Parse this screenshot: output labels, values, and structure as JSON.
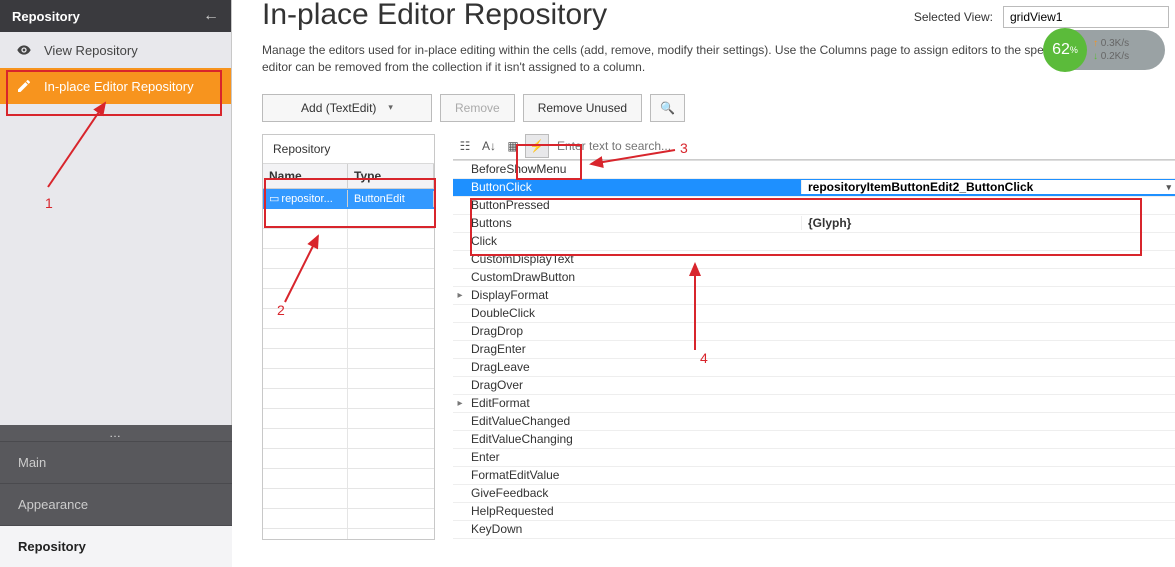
{
  "sidebar": {
    "title": "Repository",
    "items": [
      {
        "label": "View Repository"
      },
      {
        "label": "In-place Editor Repository"
      }
    ],
    "bottom": [
      {
        "label": "Main"
      },
      {
        "label": "Appearance"
      },
      {
        "label": "Repository"
      }
    ]
  },
  "page": {
    "title": "In-place Editor Repository",
    "selected_view_label": "Selected View:",
    "selected_view_value": "gridView1",
    "description": "Manage the editors used for in-place editing within the cells (add, remove, modify their settings). Use the Columns page to assign editors to the specific columns. The editor can be removed from the collection if it isn't assigned to a column."
  },
  "toolbar": {
    "add_label": "Add (TextEdit)",
    "remove_label": "Remove",
    "remove_unused_label": "Remove Unused",
    "search_icon": "search-icon"
  },
  "repo_panel": {
    "title": "Repository",
    "headers": {
      "name": "Name",
      "type": "Type"
    },
    "rows": [
      {
        "name": "repositor...",
        "type": "ButtonEdit"
      }
    ]
  },
  "prop_toolbar": {
    "search_placeholder": "Enter text to search...",
    "categorized_icon": "categorized-icon",
    "alpha_icon": "alphabetical-icon",
    "props_icon": "property-pages-icon",
    "events_icon": "events-icon"
  },
  "prop_grid": [
    {
      "name": "BeforeShowMenu",
      "value": ""
    },
    {
      "name": "ButtonClick",
      "value": "repositoryItemButtonEdit2_ButtonClick",
      "selected": true
    },
    {
      "name": "ButtonPressed",
      "value": ""
    },
    {
      "name": "Buttons",
      "value": "{Glyph}",
      "bold": true
    },
    {
      "name": "Click",
      "value": ""
    },
    {
      "name": "CustomDisplayText",
      "value": ""
    },
    {
      "name": "CustomDrawButton",
      "value": ""
    },
    {
      "name": "DisplayFormat",
      "value": "",
      "expand": true
    },
    {
      "name": "DoubleClick",
      "value": ""
    },
    {
      "name": "DragDrop",
      "value": ""
    },
    {
      "name": "DragEnter",
      "value": ""
    },
    {
      "name": "DragLeave",
      "value": ""
    },
    {
      "name": "DragOver",
      "value": ""
    },
    {
      "name": "EditFormat",
      "value": "",
      "expand": true
    },
    {
      "name": "EditValueChanged",
      "value": ""
    },
    {
      "name": "EditValueChanging",
      "value": ""
    },
    {
      "name": "Enter",
      "value": ""
    },
    {
      "name": "FormatEditValue",
      "value": ""
    },
    {
      "name": "GiveFeedback",
      "value": ""
    },
    {
      "name": "HelpRequested",
      "value": ""
    },
    {
      "name": "KeyDown",
      "value": ""
    }
  ],
  "annotations": {
    "n1": "1",
    "n2": "2",
    "n3": "3",
    "n4": "4"
  },
  "speed": {
    "percent": "62",
    "pct_sign": "%",
    "up": "0.3K/s",
    "down": "0.2K/s"
  }
}
